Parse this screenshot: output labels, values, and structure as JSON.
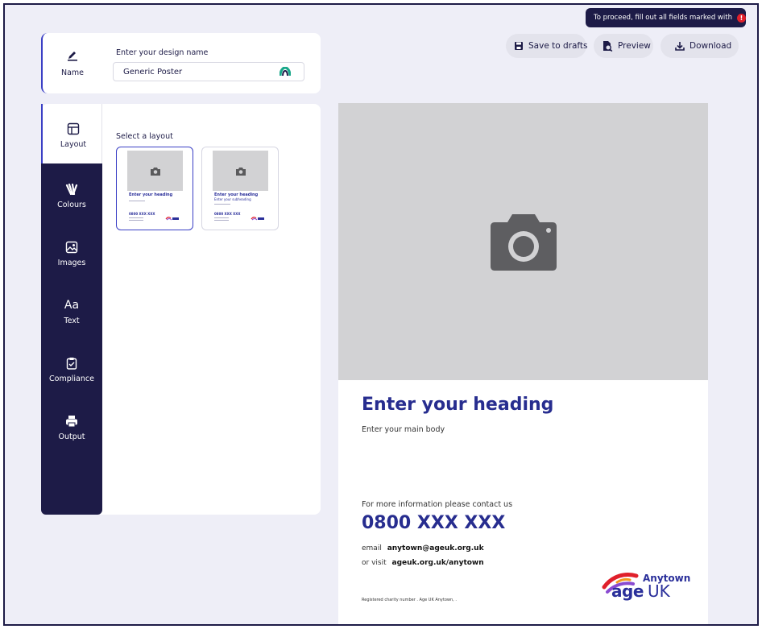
{
  "warning": {
    "text": "To proceed, fill out all fields marked with",
    "marker": "!"
  },
  "toolbar": {
    "save_label": "Save to drafts",
    "preview_label": "Preview",
    "download_label": "Download"
  },
  "name_section": {
    "tab_label": "Name",
    "field_label": "Enter your design name",
    "field_value": "Generic Poster"
  },
  "tabs": [
    {
      "label": "Layout",
      "icon": "layout-icon"
    },
    {
      "label": "Colours",
      "icon": "colours-icon"
    },
    {
      "label": "Images",
      "icon": "image-icon"
    },
    {
      "label": "Text",
      "icon": "text-icon",
      "glyph": "Aa"
    },
    {
      "label": "Compliance",
      "icon": "clipboard-check-icon"
    },
    {
      "label": "Output",
      "icon": "printer-icon"
    }
  ],
  "layout_panel": {
    "title": "Select a layout",
    "thumbs": [
      {
        "heading": "Enter your heading",
        "subheading": "",
        "phone": "0800 XXX XXX"
      },
      {
        "heading": "Enter your heading",
        "subheading": "Enter your subheading",
        "phone": "0800 XXX XXX"
      }
    ]
  },
  "poster": {
    "heading": "Enter your heading",
    "body": "Enter your main body",
    "contact_intro": "For more information please contact us",
    "phone": "0800 XXX XXX",
    "email_label": "email",
    "email_value": "anytown@ageuk.org.uk",
    "visit_label": "or visit",
    "visit_value": "ageuk.org.uk/anytown",
    "registered": "Registered charity number . Age UK Anytown, .",
    "logo_town": "Anytown",
    "logo_age": "age",
    "logo_uk": "UK"
  },
  "colors": {
    "navy": "#1d1b47",
    "accent": "#3a3fc5",
    "heading": "#272d8f",
    "placeholder": "#d2d2d4"
  }
}
